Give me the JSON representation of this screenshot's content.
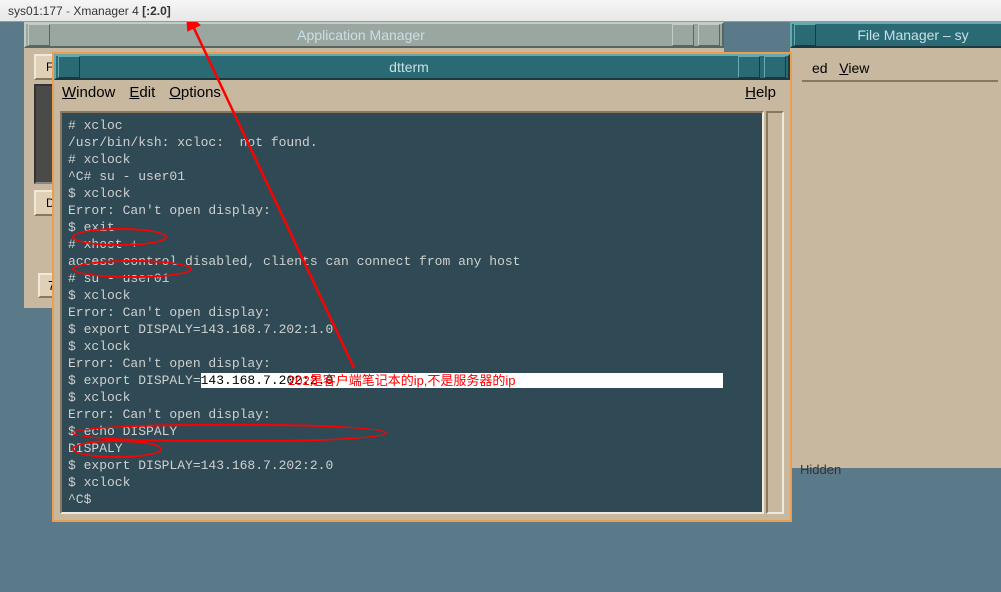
{
  "xmanager": {
    "host": "sys01:177",
    "app": "Xmanager 4",
    "display": "[:2.0]"
  },
  "app_manager": {
    "title": "Application Manager",
    "tab_label": "F",
    "tab_label2": "D",
    "page_number": "7"
  },
  "file_manager": {
    "title": "File Manager – sy",
    "menu": {
      "ed_suffix": "ed",
      "view": "View"
    },
    "hidden_label": "Hidden"
  },
  "dtterm": {
    "title": "dtterm",
    "menus": {
      "window": "Window",
      "edit": "Edit",
      "options": "Options",
      "help": "Help"
    },
    "terminal_lines": [
      "# xcloc",
      "/usr/bin/ksh: xcloc:  not found.",
      "# xclock",
      "^C# su - user01",
      "$ xclock",
      "Error: Can't open display:",
      "$ exit",
      "# xhost +",
      "access control disabled, clients can connect from any host",
      "# su - user01",
      "$ xclock",
      "Error: Can't open display:",
      "$ export DISPALY=143.168.7.202:1.0",
      "$ xclock",
      "Error: Can't open display:",
      "$ export DISPALY=",
      "143.168.7.202:2.0",
      "$ xclock",
      "Error: Can't open display:",
      "$ echo DISPALY",
      "DISPALY",
      "$ export DISPLAY=143.168.7.202:2.0",
      "$ xclock",
      "^C$"
    ],
    "highlighted_line_index": 15
  },
  "annotation_text": "202是客户端笔记本的ip,不是服务器的ip"
}
